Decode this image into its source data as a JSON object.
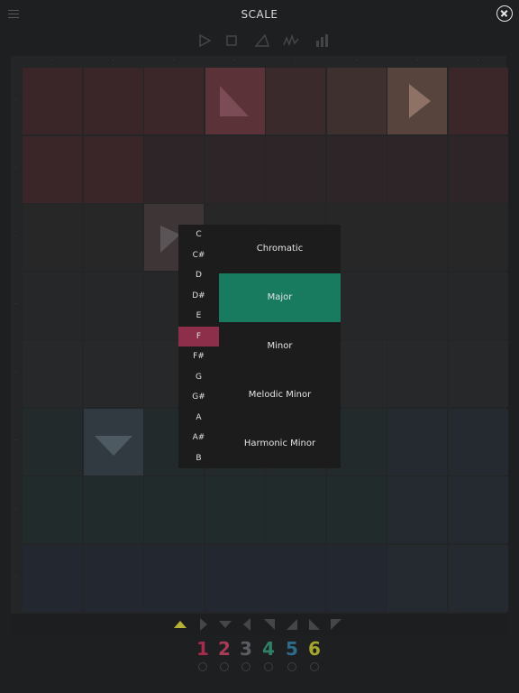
{
  "header": {
    "title": "SCALE",
    "menu_icon": "hamburger-menu-icon",
    "close_icon": "close-circle-icon"
  },
  "toolbar": {
    "icons": [
      "play-icon",
      "stop-icon",
      "triangle-tool-icon",
      "wave-icon",
      "bars-icon"
    ]
  },
  "key_picker": {
    "keys": [
      "C",
      "C#",
      "D",
      "D#",
      "E",
      "F",
      "F#",
      "G",
      "G#",
      "A",
      "A#",
      "B"
    ],
    "selected": "F"
  },
  "scale_picker": {
    "scales": [
      "Chromatic",
      "Major",
      "Minor",
      "Melodic Minor",
      "Harmonic Minor"
    ],
    "selected": "Major"
  },
  "bottom_bar": {
    "shapes": [
      "up-triangle-icon",
      "right-triangle-icon",
      "down-triangle-icon",
      "left-triangle-icon",
      "corner-top-left-icon",
      "corner-bottom-right-icon",
      "corner-bottom-left-icon",
      "corner-top-right-icon"
    ],
    "tracks": [
      {
        "label": "1",
        "color": "#a62c4b"
      },
      {
        "label": "2",
        "color": "#a83b56"
      },
      {
        "label": "3",
        "color": "#5a5e63"
      },
      {
        "label": "4",
        "color": "#2f7f69"
      },
      {
        "label": "5",
        "color": "#2d6b8a"
      },
      {
        "label": "6",
        "color": "#a5a72c"
      }
    ]
  },
  "colors": {
    "accent_green": "#187a5f",
    "accent_red": "#8d2f4a",
    "shape_active": "#b5b236"
  }
}
